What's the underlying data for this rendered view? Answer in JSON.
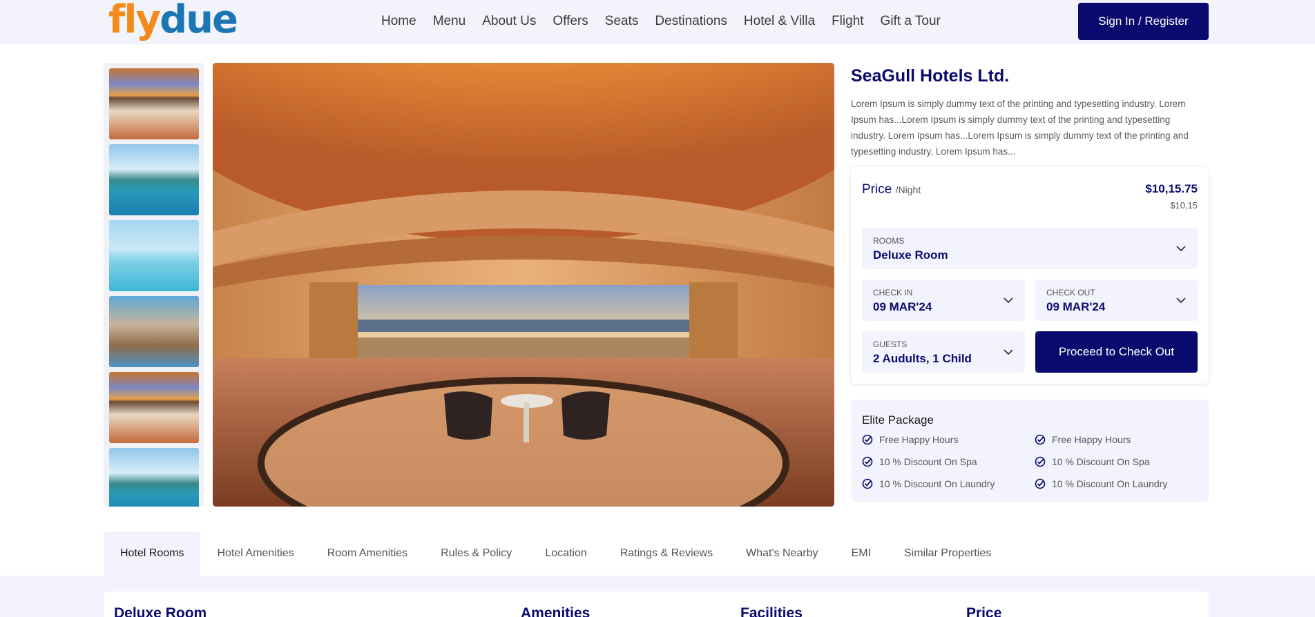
{
  "header": {
    "logo_part1": "fly",
    "logo_part2": "due",
    "nav": [
      "Home",
      "Menu",
      "About Us",
      "Offers",
      "Seats",
      "Destinations",
      "Hotel & Villa",
      "Flight",
      "Gift a Tour"
    ],
    "signin_label": "Sign In / Register"
  },
  "gallery": {
    "thumbnails": [
      "dome-lobby-image",
      "cruise-sea-image",
      "calm-sea-image",
      "world-landmarks-image",
      "dome-lobby-image",
      "cruise-sea-image"
    ],
    "main_image": "dome-lobby-image"
  },
  "hotel": {
    "name": "SeaGull Hotels Ltd.",
    "description": "Lorem Ipsum is simply dummy text of the printing and typesetting industry. Lorem Ipsum has...Lorem Ipsum is simply dummy text of the printing and typesetting industry. Lorem Ipsum has...Lorem Ipsum is simply dummy text of the printing and typesetting industry. Lorem Ipsum has..."
  },
  "booking": {
    "price_label": "Price",
    "price_unit": "/Night",
    "price_value": "$10,15.75",
    "price_sub": "$10,15",
    "rooms_label": "ROOMS",
    "rooms_value": "Deluxe Room",
    "checkin_label": "CHECK IN",
    "checkin_value": "09 MAR'24",
    "checkout_label": "CHECK OUT",
    "checkout_value": "09 MAR'24",
    "guests_label": "GUESTS",
    "guests_value": "2 Audults, 1 Child",
    "proceed_label": "Proceed to Check Out"
  },
  "elite": {
    "title": "Elite Package",
    "perks_left": [
      "Free Happy Hours",
      "10 % Discount On Spa",
      "10 % Discount On Laundry"
    ],
    "perks_right": [
      "Free Happy Hours",
      "10 % Discount On Spa",
      "10 % Discount On Laundry"
    ]
  },
  "tabs": [
    "Hotel Rooms",
    "Hotel Amenities",
    "Room Amenities",
    "Rules & Policy",
    "Location",
    "Ratings & Reviews",
    "What's Nearby",
    "EMI",
    "Similar Properties"
  ],
  "rooms_section": {
    "room_name": "Deluxe Room",
    "amenities": "Amenities",
    "facilities": "Facilities",
    "price": "Price"
  },
  "colors": {
    "brand_navy": "#0a0a6e",
    "logo_orange": "#f28b1c",
    "logo_blue": "#1c76b3",
    "panel_bg": "#f2f3fc"
  }
}
